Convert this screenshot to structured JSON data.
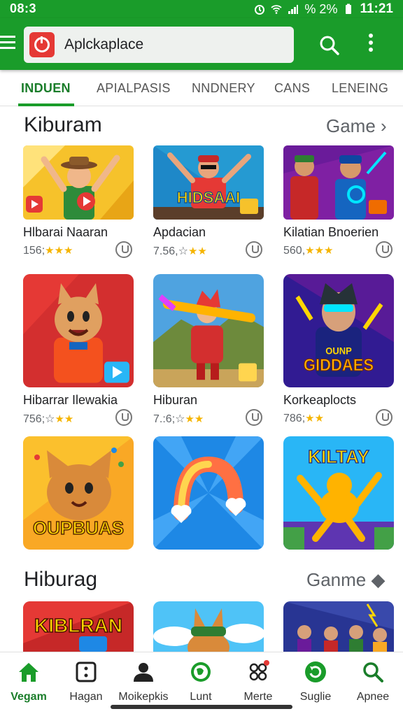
{
  "status_bar": {
    "time": "08:3",
    "battery": "% 2%",
    "clock": "11:21"
  },
  "app_bar": {
    "search_text": "Aplckaplace",
    "search_icon": "search-icon",
    "more_icon": "more-vert-icon",
    "menu_icon": "menu-icon",
    "logo_icon": "app-logo-icon"
  },
  "tabs": [
    {
      "label": "INDUEN",
      "active": true
    },
    {
      "label": "APIALPASIS",
      "active": false
    },
    {
      "label": "NNDNERY",
      "active": false
    },
    {
      "label": "CANS",
      "active": false
    },
    {
      "label": "LENEING",
      "active": false
    }
  ],
  "sections": [
    {
      "title": "Kiburam",
      "more": "Game ›"
    },
    {
      "title": "Hiburag",
      "more": "Ganme ◆"
    }
  ],
  "row1": [
    {
      "name": "Hlbarai Naaran",
      "rating": "156;",
      "stars": "★★★"
    },
    {
      "name": "Apdacian",
      "rating": "7.56,☆",
      "stars": "★★"
    },
    {
      "name": "Kilatian Bnoerien",
      "rating": "560,",
      "stars": "★★★"
    }
  ],
  "row2": [
    {
      "name": "Hibarrar Ilewakia",
      "rating": "756;☆",
      "stars": "★★"
    },
    {
      "name": "Hiburan",
      "rating": "7.:6;☆",
      "stars": "★★"
    },
    {
      "name": "Korkeaplocts",
      "rating": "786;",
      "stars": "★★"
    }
  ],
  "thumb_text": {
    "hidsaai": "HIDSAAI",
    "gidaes": "GIDDAES",
    "gidaes_top": "OUNP",
    "oupbuas": "OUPBUAS",
    "kiltay": "KILTAY",
    "kiblran": "KIBLRAN"
  },
  "bottom_nav": [
    {
      "label": "Vegam",
      "icon": "home-icon",
      "active": true
    },
    {
      "label": "Hagan",
      "icon": "dice-icon",
      "active": false
    },
    {
      "label": "Moikepkis",
      "icon": "person-icon",
      "active": false
    },
    {
      "label": "Lunt",
      "icon": "globe-icon",
      "active": false
    },
    {
      "label": "Merte",
      "icon": "apps-icon",
      "active": false
    },
    {
      "label": "Suglie",
      "icon": "refresh-icon",
      "active": false
    },
    {
      "label": "Apnee",
      "icon": "search-icon",
      "active": false
    }
  ],
  "colors": {
    "primary": "#1a9c2a",
    "accent_text": "#1a7d2a",
    "star": "#f5b400"
  }
}
